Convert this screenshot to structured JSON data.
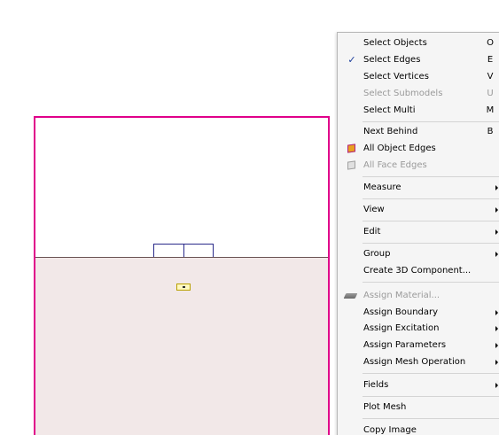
{
  "menu": {
    "items": [
      {
        "label": "Select Objects",
        "shortcut": "O"
      },
      {
        "label": "Select Edges",
        "shortcut": "E",
        "checked": true
      },
      {
        "label": "Select Vertices",
        "shortcut": "V"
      },
      {
        "label": "Select Submodels",
        "shortcut": "U",
        "disabled": true
      },
      {
        "label": "Select Multi",
        "shortcut": "M"
      },
      {
        "label": "Next Behind",
        "shortcut": "B"
      },
      {
        "label": "All Object Edges",
        "icon": "colored-cube-icon"
      },
      {
        "label": "All Face Edges",
        "icon": "gray-cube-icon",
        "disabled": true
      },
      {
        "label": "Measure",
        "submenu": true
      },
      {
        "label": "View",
        "submenu": true
      },
      {
        "label": "Edit",
        "submenu": true
      },
      {
        "label": "Group",
        "submenu": true
      },
      {
        "label": "Create 3D Component..."
      },
      {
        "label": "Assign Material...",
        "icon": "material-icon",
        "disabled": true
      },
      {
        "label": "Assign Boundary",
        "submenu": true
      },
      {
        "label": "Assign Excitation",
        "submenu": true
      },
      {
        "label": "Assign Parameters",
        "submenu": true
      },
      {
        "label": "Assign Mesh Operation",
        "submenu": true
      },
      {
        "label": "Fields",
        "submenu": true
      },
      {
        "label": "Plot Mesh"
      },
      {
        "label": "Copy Image"
      }
    ],
    "check_glyph": "✓"
  },
  "colors": {
    "selection_outline": "#e0008a",
    "menu_background": "#f5f5f5",
    "disabled_text": "#9a9a9a",
    "lower_region": "#f2e8e8"
  }
}
